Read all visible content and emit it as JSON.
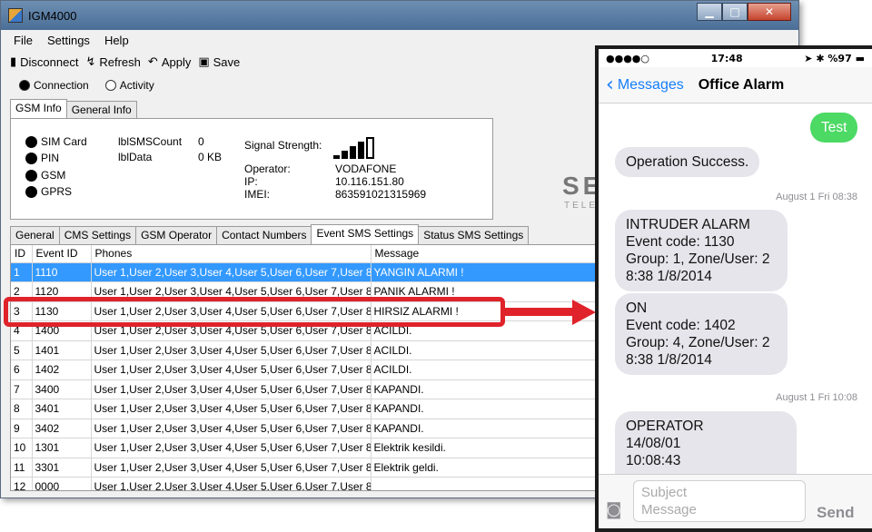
{
  "app": {
    "title": "IGM4000",
    "menu": [
      "File",
      "Settings",
      "Help"
    ],
    "toolbar": {
      "disconnect": "Disconnect",
      "refresh": "Refresh",
      "apply": "Apply",
      "save": "Save"
    },
    "radios": {
      "connection": "Connection",
      "activity": "Activity"
    },
    "top_tabs": [
      "GSM Info",
      "General Info"
    ],
    "gsm": {
      "sim_card": "SIM Card",
      "pin": "PIN",
      "gsm": "GSM",
      "gprs": "GPRS",
      "sms_count_label": "lblSMSCount",
      "sms_count_value": "0",
      "data_label": "lblData",
      "data_value": "0 KB",
      "signal_label": "Signal Strength:",
      "operator_label": "Operator:",
      "operator_value": "VODAFONE",
      "ip_label": "IP:",
      "ip_value": "10.116.151.80",
      "imei_label": "IMEI:",
      "imei_value": "863591021315969"
    },
    "logo_partial": "SE",
    "logo_sub_partial": "TELE",
    "bottom_tabs": [
      "General",
      "CMS Settings",
      "GSM Operator",
      "Contact Numbers",
      "Event SMS Settings",
      "Status SMS Settings"
    ],
    "table": {
      "headers": [
        "ID",
        "Event ID",
        "Phones",
        "Message"
      ],
      "rows": [
        [
          "1",
          "1110",
          "User 1,User 2,User 3,User 4,User 5,User 6,User 7,User 8",
          "YANGIN ALARMI !"
        ],
        [
          "2",
          "1120",
          "User 1,User 2,User 3,User 4,User 5,User 6,User 7,User 8",
          "PANIK ALARMI !"
        ],
        [
          "3",
          "1130",
          "User 1,User 2,User 3,User 4,User 5,User 6,User 7,User 8",
          "HIRSIZ ALARMI !"
        ],
        [
          "4",
          "1400",
          "User 1,User 2,User 3,User 4,User 5,User 6,User 7,User 8",
          "ACILDI."
        ],
        [
          "5",
          "1401",
          "User 1,User 2,User 3,User 4,User 5,User 6,User 7,User 8",
          "ACILDI."
        ],
        [
          "6",
          "1402",
          "User 1,User 2,User 3,User 4,User 5,User 6,User 7,User 8",
          "ACILDI."
        ],
        [
          "7",
          "3400",
          "User 1,User 2,User 3,User 4,User 5,User 6,User 7,User 8",
          "KAPANDI."
        ],
        [
          "8",
          "3401",
          "User 1,User 2,User 3,User 4,User 5,User 6,User 7,User 8",
          "KAPANDI."
        ],
        [
          "9",
          "3402",
          "User 1,User 2,User 3,User 4,User 5,User 6,User 7,User 8",
          "KAPANDI."
        ],
        [
          "10",
          "1301",
          "User 1,User 2,User 3,User 4,User 5,User 6,User 7,User 8",
          "Elektrik kesildi."
        ],
        [
          "11",
          "3301",
          "User 1,User 2,User 3,User 4,User 5,User 6,User 7,User 8",
          "Elektrik geldi."
        ],
        [
          "12",
          "0000",
          "User 1,User 2,User 3,User 4,User 5,User 6,User 7,User 8",
          ""
        ]
      ]
    }
  },
  "phone": {
    "status": {
      "carrier": "●●●●○",
      "time": "17:48",
      "battery": "%97"
    },
    "back_label": "Messages",
    "conversation_title": "Office Alarm",
    "outgoing": "Test",
    "messages": [
      {
        "lines": [
          "Operation Success."
        ]
      },
      {
        "stamp": "August 1 Fri 08:38",
        "lines": [
          "INTRUDER ALARM",
          "Event code: 1130",
          "Group: 1, Zone/User: 2",
          "8:38 1/8/2014"
        ]
      },
      {
        "lines": [
          "ON",
          "Event code: 1402",
          "Group: 4, Zone/User: 2",
          "8:38 1/8/2014"
        ]
      },
      {
        "stamp": "August 1 Fri 10:08",
        "lines": [
          "OPERATOR",
          "14/08/01",
          "10:08:43"
        ]
      }
    ],
    "subject_placeholder": "Subject",
    "message_placeholder": "Message",
    "send_label": "Send"
  },
  "colors": {
    "highlight": "#e0232b",
    "selected_row": "#3399ff",
    "ios_blue": "#147efb",
    "bubble_out": "#4cd964"
  }
}
